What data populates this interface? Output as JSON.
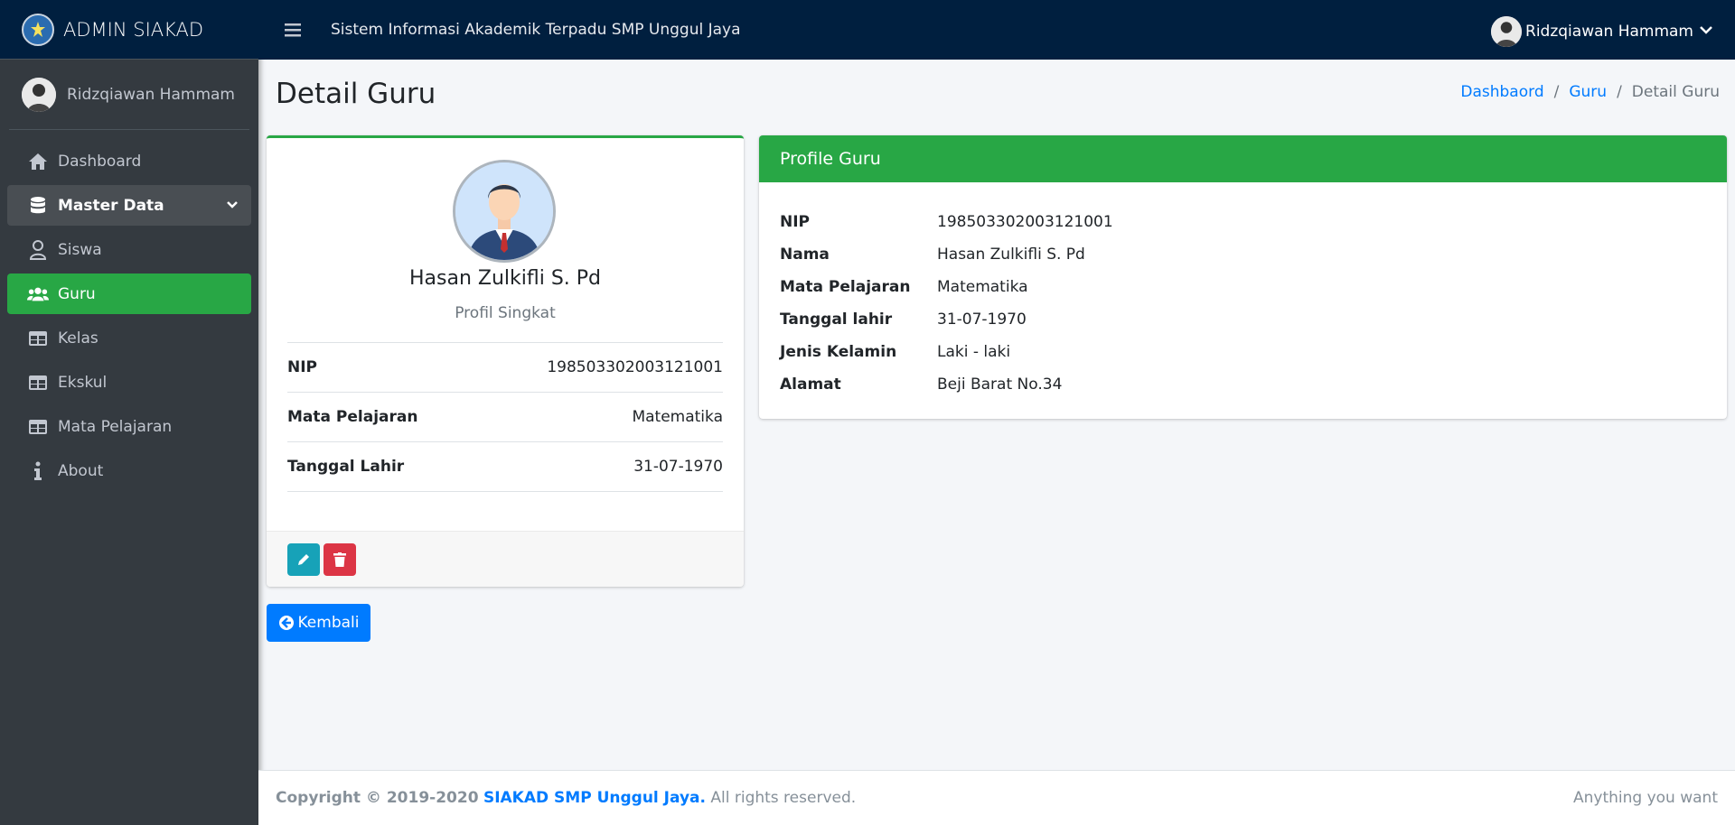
{
  "brand": {
    "title": "ADMIN SIAKAD"
  },
  "sidebar": {
    "user_name": "Ridzqiawan Hammam",
    "items": [
      {
        "label": "Dashboard",
        "icon": "home-icon"
      },
      {
        "label": "Master Data",
        "icon": "database-icon"
      },
      {
        "label": "Siswa",
        "icon": "user-icon"
      },
      {
        "label": "Guru",
        "icon": "users-icon"
      },
      {
        "label": "Kelas",
        "icon": "table-icon"
      },
      {
        "label": "Ekskul",
        "icon": "table-icon"
      },
      {
        "label": "Mata Pelajaran",
        "icon": "table-icon"
      },
      {
        "label": "About",
        "icon": "info-icon"
      }
    ]
  },
  "topbar": {
    "system_title": "Sistem Informasi Akademik Terpadu SMP Unggul Jaya",
    "user_name": "Ridzqiawan Hammam"
  },
  "page": {
    "title": "Detail Guru",
    "breadcrumb": [
      "Dashbaord",
      "Guru",
      "Detail Guru"
    ]
  },
  "profile": {
    "name": "Hasan Zulkifli S. Pd",
    "subtitle": "Profil Singkat",
    "rows": [
      {
        "label": "NIP",
        "value": "198503302003121001"
      },
      {
        "label": "Mata Pelajaran",
        "value": "Matematika"
      },
      {
        "label": "Tanggal Lahir",
        "value": "31-07-1970"
      }
    ]
  },
  "back_button": {
    "label": "Kembali"
  },
  "detail": {
    "header": "Profile Guru",
    "rows": [
      {
        "label": "NIP",
        "value": "198503302003121001"
      },
      {
        "label": "Nama",
        "value": "Hasan Zulkifli S. Pd"
      },
      {
        "label": "Mata Pelajaran",
        "value": "Matematika"
      },
      {
        "label": "Tanggal lahir",
        "value": "31-07-1970"
      },
      {
        "label": "Jenis Kelamin",
        "value": "Laki - laki"
      },
      {
        "label": "Alamat",
        "value": "Beji Barat No.34"
      }
    ]
  },
  "footer": {
    "copyright": "Copyright © 2019-2020",
    "link": "SIAKAD SMP Unggul Jaya.",
    "rights": "All rights reserved.",
    "right_text": "Anything you want"
  },
  "colors": {
    "navbar": "#001f3f",
    "sidebar": "#343a40",
    "accent_green": "#28a745",
    "primary_blue": "#007bff",
    "info": "#17a2b8",
    "danger": "#dc3545"
  }
}
